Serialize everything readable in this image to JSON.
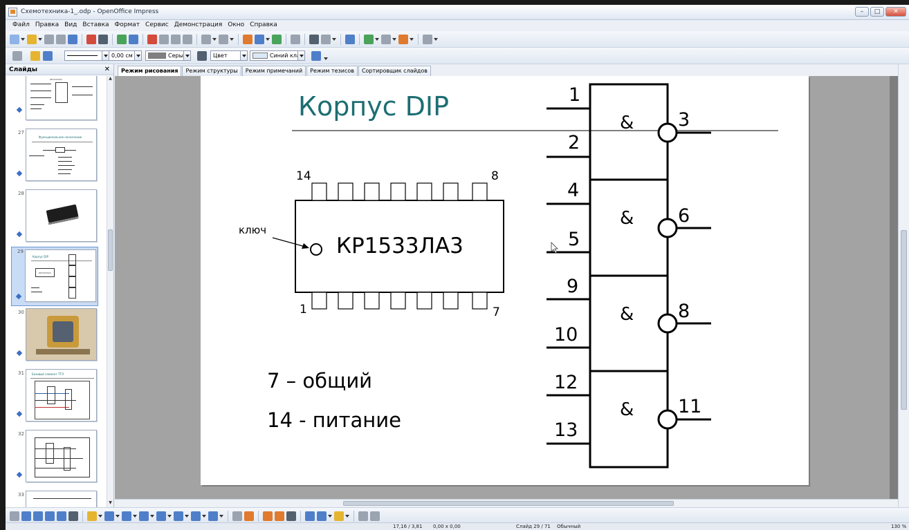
{
  "window": {
    "title": "Схемотехника-1_.odp - OpenOffice Impress",
    "controls": [
      "–",
      "□",
      "✕"
    ]
  },
  "menu": [
    "Файл",
    "Правка",
    "Вид",
    "Вставка",
    "Формат",
    "Сервис",
    "Демонстрация",
    "Окно",
    "Справка"
  ],
  "line_toolbar": {
    "width_value": "0,00 см",
    "area_color": "Серый",
    "area_fill_type": "Цвет",
    "area_fill_value": "Синий кла"
  },
  "slides_panel": {
    "header": "Слайды",
    "close": "✕",
    "visible_numbers": [
      "27",
      "28",
      "29",
      "30",
      "31",
      "32",
      "33"
    ],
    "selected": "29",
    "thumb_texts": {
      "s26_chip": "КР1533ЛА3",
      "s27_title": "Функциональное назначение",
      "s29_title": "Корпус DIP",
      "s29_chip": "КР1533ЛА3",
      "s31_title": "Базовый элемент ТТЛ"
    }
  },
  "view_tabs": [
    "Режим рисования",
    "Режим структуры",
    "Режим примечаний",
    "Режим тезисов",
    "Сортировщик слайдов"
  ],
  "active_tab": "Режим рисования",
  "slide": {
    "title": "Корпус DIP",
    "chip_label": "КР1533ЛА3",
    "key_label": "ключ",
    "pin_top_left": "14",
    "pin_top_right": "8",
    "pin_bottom_left": "1",
    "pin_bottom_right": "7",
    "note_common": "7 – общий",
    "note_power": "14 - питание",
    "gates": [
      {
        "symbol": "&",
        "inputs": [
          "1",
          "2"
        ],
        "output": "3"
      },
      {
        "symbol": "&",
        "inputs": [
          "4",
          "5"
        ],
        "output": "6"
      },
      {
        "symbol": "&",
        "inputs": [
          "9",
          "10"
        ],
        "output": "8"
      },
      {
        "symbol": "&",
        "inputs": [
          "12",
          "13"
        ],
        "output": "11"
      }
    ]
  },
  "status": {
    "position": "17,16 / 3,81",
    "size": "0,00 x 0,00",
    "slide": "Слайд 29 / 71",
    "layout": "Обычный",
    "zoom": "130 %"
  }
}
